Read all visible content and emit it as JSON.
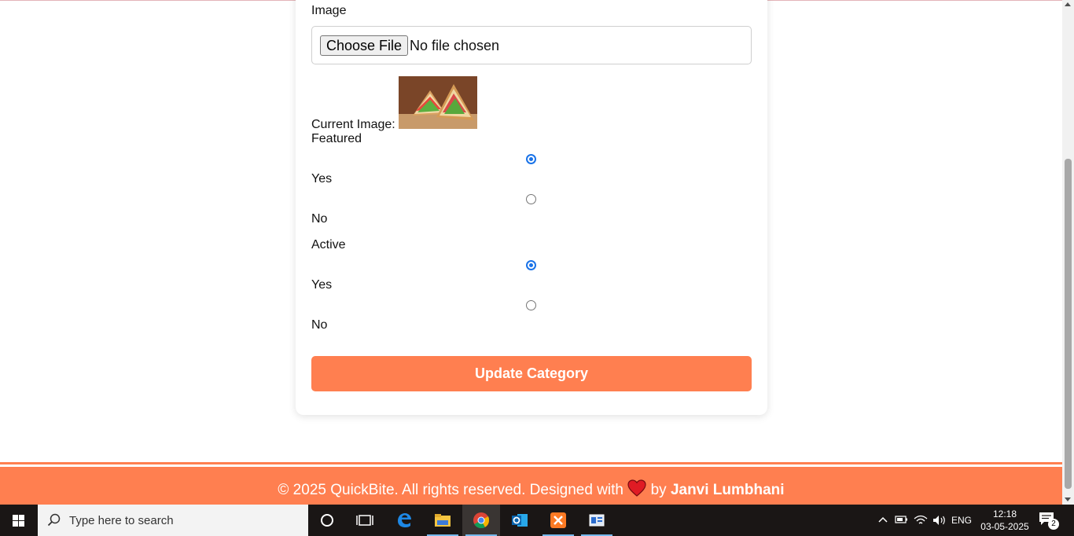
{
  "form": {
    "image_label": "Image",
    "file_button": "Choose File",
    "file_status": "No file chosen",
    "current_image_label": "Current Image:",
    "featured_label": "Featured",
    "featured_yes": "Yes",
    "featured_no": "No",
    "featured_value": "Yes",
    "active_label": "Active",
    "active_yes": "Yes",
    "active_no": "No",
    "active_value": "Yes",
    "submit_label": "Update Category"
  },
  "footer": {
    "prefix": "© 2025 QuickBite. All rights reserved. Designed with",
    "by": "by",
    "author": "Janvi Lumbhani"
  },
  "taskbar": {
    "search_placeholder": "Type here to search",
    "language": "ENG",
    "time": "12:18",
    "date": "03-05-2025",
    "notification_count": "2"
  },
  "colors": {
    "accent": "#ff7f50",
    "radio_checked": "#1a73e8"
  }
}
